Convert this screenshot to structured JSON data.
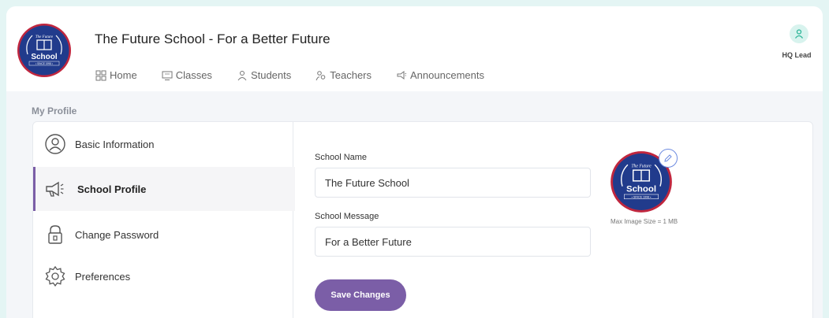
{
  "header": {
    "title": "The Future School - For a Better Future",
    "logo": {
      "top_text": "The Future",
      "main_text": "School",
      "bottom_text": "• SINCE 1998 •"
    },
    "nav": [
      {
        "label": "Home",
        "icon": "grid-icon"
      },
      {
        "label": "Classes",
        "icon": "monitor-icon"
      },
      {
        "label": "Students",
        "icon": "student-icon"
      },
      {
        "label": "Teachers",
        "icon": "teachers-icon"
      },
      {
        "label": "Announcements",
        "icon": "megaphone-icon"
      }
    ],
    "user": {
      "label": "HQ Lead",
      "icon": "user-icon"
    }
  },
  "page": {
    "section_title": "My Profile"
  },
  "sidebar": {
    "items": [
      {
        "label": "Basic Information",
        "icon": "user-circle-icon"
      },
      {
        "label": "School Profile",
        "icon": "megaphone-icon",
        "active": true
      },
      {
        "label": "Change Password",
        "icon": "lock-icon"
      },
      {
        "label": "Preferences",
        "icon": "gear-icon"
      }
    ]
  },
  "form": {
    "school_name_label": "School Name",
    "school_name_value": "The Future School",
    "school_message_label": "School Message",
    "school_message_value": "For a Better Future",
    "save_label": "Save Changes",
    "max_image_size": "Max Image Size = 1 MB"
  },
  "colors": {
    "accent": "#7b5ea7",
    "logo_navy": "#213b8c",
    "logo_ring": "#c0263e",
    "user_green": "#2bb597"
  }
}
